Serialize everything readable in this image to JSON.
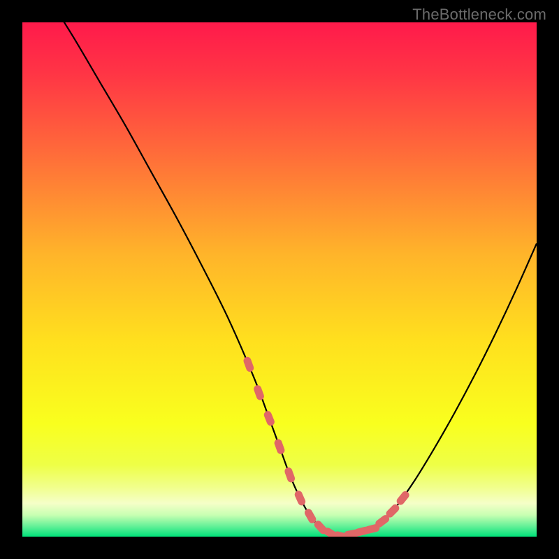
{
  "watermark": "TheBottleneck.com",
  "colors": {
    "background": "#000000",
    "curve": "#000000",
    "marker_fill": "#e06767",
    "marker_stroke": "#c85353",
    "gradient_stops": [
      {
        "offset": 0.0,
        "color": "#ff1a4b"
      },
      {
        "offset": 0.1,
        "color": "#ff3545"
      },
      {
        "offset": 0.25,
        "color": "#ff6a3a"
      },
      {
        "offset": 0.45,
        "color": "#ffb42a"
      },
      {
        "offset": 0.62,
        "color": "#ffe01e"
      },
      {
        "offset": 0.78,
        "color": "#f9ff1e"
      },
      {
        "offset": 0.86,
        "color": "#eeff46"
      },
      {
        "offset": 0.905,
        "color": "#f1ff8e"
      },
      {
        "offset": 0.935,
        "color": "#f5ffc8"
      },
      {
        "offset": 0.958,
        "color": "#c8ffb2"
      },
      {
        "offset": 0.978,
        "color": "#6cf29a"
      },
      {
        "offset": 1.0,
        "color": "#00e27a"
      }
    ]
  },
  "chart_data": {
    "type": "line",
    "title": "",
    "xlabel": "",
    "ylabel": "",
    "xlim": [
      0,
      100
    ],
    "ylim": [
      0,
      100
    ],
    "grid": false,
    "series": [
      {
        "name": "bottleneck-curve",
        "x": [
          5,
          10,
          15,
          20,
          25,
          30,
          35,
          40,
          45,
          48,
          50,
          52,
          54,
          56,
          58,
          60,
          62,
          65,
          68,
          72,
          76,
          80,
          84,
          88,
          92,
          96,
          100
        ],
        "y": [
          105,
          97,
          88.5,
          80,
          71,
          62,
          52.5,
          42.5,
          31,
          23,
          17.5,
          12,
          7.5,
          4,
          1.8,
          0.6,
          0.1,
          0.2,
          1.5,
          5,
          10.5,
          17,
          24,
          31.5,
          39.5,
          48,
          57
        ]
      }
    ],
    "markers": {
      "name": "highlight-dots",
      "x": [
        44,
        46,
        48,
        50,
        52,
        54,
        56,
        58,
        60,
        62,
        64,
        66,
        68,
        70,
        72,
        74
      ],
      "y": [
        33.5,
        28,
        23,
        17.5,
        12,
        7.5,
        4,
        1.8,
        0.6,
        0.1,
        0.5,
        1,
        1.5,
        3,
        5,
        7.5
      ]
    }
  }
}
